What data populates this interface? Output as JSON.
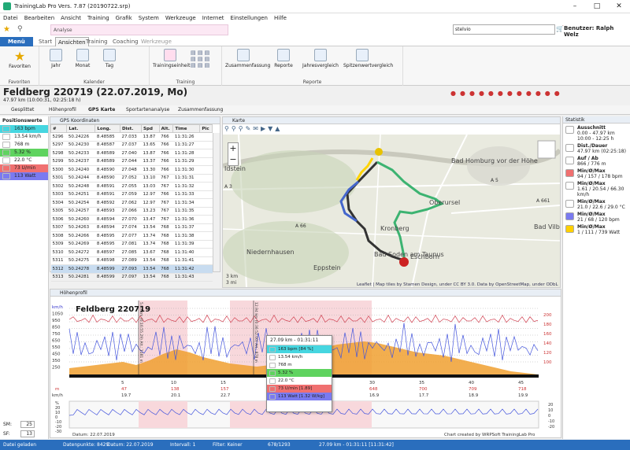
{
  "window": {
    "title": "TrainingLab Pro Vers. 7.87 (20190722.srp)"
  },
  "menu": [
    "Datei",
    "Bearbeiten",
    "Ansicht",
    "Training",
    "Grafik",
    "System",
    "Werkzeuge",
    "Internet",
    "Einstellungen",
    "Hilfe"
  ],
  "quick": {
    "analyse": "Analyse",
    "user_value": "stelvio",
    "user_label": "Benutzer: Ralph Welz"
  },
  "ribbon_tabs": [
    "Menü",
    "Start",
    "Ansichten",
    "Training",
    "Coaching",
    "Werkzeuge"
  ],
  "ribbon": {
    "favoriten": {
      "btn": "Favoriten",
      "label": "Favoriten"
    },
    "kalender": {
      "btns": [
        "Jahr",
        "Monat",
        "Tag"
      ],
      "label": "Kalender"
    },
    "training": {
      "btns": [
        "Trainingseinheit"
      ],
      "label": "Training"
    },
    "reporte": {
      "btns": [
        "Zusammenfassung",
        "Reporte",
        "Jahresvergleich",
        "Spitzenwertvergleich"
      ],
      "label": "Reporte"
    }
  },
  "session": {
    "title": "Feldberg 220719 (22.07.2019, Mo)",
    "sub": "47.97 km (10:00:31, 02:25:18 h)"
  },
  "subtabs": [
    "Gesplittet",
    "Höhenprofil",
    "GPS Karte",
    "Sportartenanalyse",
    "Zusammenfassung"
  ],
  "positions": {
    "head": "Positionswerte",
    "items": [
      {
        "text": "163 bpm",
        "color": "#46d6e0"
      },
      {
        "text": "13.54 km/h",
        "color": "#ffffff"
      },
      {
        "text": "768 m",
        "color": "#ffffff"
      },
      {
        "text": "5.32 %",
        "color": "#5fd35f"
      },
      {
        "text": "22.0 °C",
        "color": "#ffffff"
      },
      {
        "text": "73 U/min",
        "color": "#f07070"
      },
      {
        "text": "113 Watt",
        "color": "#7a7af0"
      }
    ],
    "sm_label": "SM:",
    "sm_value": "25",
    "sf_label": "SF:",
    "sf_value": "13"
  },
  "grid": {
    "head": "GPS Koordinaten",
    "columns": [
      "#",
      "Lat.",
      "Long.",
      "Dist.",
      "Spd",
      "Alt.",
      "Time",
      "Pic"
    ],
    "rows": [
      [
        "5296",
        "50.24226",
        "8.48585",
        "27.033",
        "13.87",
        "766",
        "11:31:26"
      ],
      [
        "5297",
        "50.24230",
        "8.48587",
        "27.037",
        "13.65",
        "766",
        "11:31:27"
      ],
      [
        "5298",
        "50.24233",
        "8.48589",
        "27.040",
        "13.87",
        "766",
        "11:31:28"
      ],
      [
        "5299",
        "50.24237",
        "8.48589",
        "27.044",
        "13.37",
        "766",
        "11:31:29"
      ],
      [
        "5300",
        "50.24240",
        "8.48590",
        "27.048",
        "13.30",
        "766",
        "11:31:30"
      ],
      [
        "5301",
        "50.24244",
        "8.48590",
        "27.052",
        "13.10",
        "767",
        "11:31:31"
      ],
      [
        "5302",
        "50.24248",
        "8.48591",
        "27.055",
        "13.03",
        "767",
        "11:31:32"
      ],
      [
        "5303",
        "50.24251",
        "8.48591",
        "27.059",
        "12.97",
        "766",
        "11:31:33"
      ],
      [
        "5304",
        "50.24254",
        "8.48592",
        "27.062",
        "12.97",
        "767",
        "11:31:34"
      ],
      [
        "5305",
        "50.24257",
        "8.48593",
        "27.066",
        "13.23",
        "767",
        "11:31:35"
      ],
      [
        "5306",
        "50.24260",
        "8.48594",
        "27.070",
        "13.47",
        "767",
        "11:31:36"
      ],
      [
        "5307",
        "50.24263",
        "8.48594",
        "27.074",
        "13.54",
        "768",
        "11:31:37"
      ],
      [
        "5308",
        "50.24266",
        "8.48595",
        "27.077",
        "13.74",
        "768",
        "11:31:38"
      ],
      [
        "5309",
        "50.24269",
        "8.48595",
        "27.081",
        "13.74",
        "768",
        "11:31:39"
      ],
      [
        "5310",
        "50.24272",
        "8.48597",
        "27.085",
        "13.67",
        "768",
        "11:31:40"
      ],
      [
        "5311",
        "50.24275",
        "8.48598",
        "27.089",
        "13.54",
        "768",
        "11:31:41"
      ],
      [
        "5312",
        "50.24278",
        "8.48599",
        "27.093",
        "13.54",
        "768",
        "11:31:42"
      ],
      [
        "5313",
        "50.24281",
        "8.48599",
        "27.097",
        "13.54",
        "768",
        "11:31:43"
      ]
    ]
  },
  "map": {
    "head": "Karte",
    "places": [
      "Bad Homburg vor der Höhe",
      "Bad Vilbel",
      "Niedernhausen",
      "Eppstein",
      "Kronberg",
      "Bad Soden am Taunus",
      "Eschborn",
      "Oberursel",
      "Idstein"
    ],
    "roads": [
      "A 3",
      "A 5",
      "A 661",
      "A 66"
    ],
    "scale": "3 km",
    "scale2": "3 mi",
    "attribution": "Leaflet | Map tiles by Stamen Design, under CC BY 3.0. Data by OpenStreetMap, under ODbL"
  },
  "stats": {
    "head": "Statistik",
    "items": [
      {
        "k": "Ausschnitt",
        "v": "0.00 - 47.97 km\n10:00 - 12:25 h",
        "color": "#ffffff"
      },
      {
        "k": "Dist./Dauer",
        "v": "47.97 km (02:25:18)",
        "color": "#ffffff"
      },
      {
        "k": "Auf / Ab",
        "v": "866 / 776 m",
        "color": "#ffffff"
      },
      {
        "k": "Min/Ø/Max",
        "v": "94 / 157 / 178 bpm",
        "color": "#f07070"
      },
      {
        "k": "Min/Ø/Max",
        "v": "1.61 / 20.54 / 66.30 km/h",
        "color": "#ffffff"
      },
      {
        "k": "Min/Ø/Max",
        "v": "21.0 / 22.6 / 29.0 °C",
        "color": "#ffffff"
      },
      {
        "k": "Min/Ø/Max",
        "v": "21 / 68 / 120 bpm",
        "color": "#7a7af0"
      },
      {
        "k": "Min/Ø/Max",
        "v": "1 / 111 / 739 Watt",
        "color": "#ffd000"
      }
    ]
  },
  "chart": {
    "head": "Höhenprofil",
    "title": "Feldberg 220719",
    "left_axis_labels": [
      "km/h",
      "1050",
      "950",
      "850",
      "750",
      "650",
      "550",
      "450",
      "350",
      "250"
    ],
    "right_axis_labels": [
      "200",
      "180",
      "160",
      "140",
      "120",
      "100"
    ],
    "km_ticks": [
      "5",
      "10",
      "15",
      "20",
      "25",
      "30",
      "35",
      "40",
      "45"
    ],
    "row_m": [
      "47",
      "138",
      "157",
      "",
      "",
      "648",
      "700",
      "709",
      "718"
    ],
    "row_kmh": [
      "19.7",
      "20.1",
      "22.7",
      "",
      "",
      "16.9",
      "17.7",
      "18.9",
      "19.9"
    ],
    "left_unit_m": "m",
    "left_unit_kmh": "km/h",
    "lower_left": [
      "%",
      "20",
      "10",
      "0",
      "-10",
      "-20",
      "-30"
    ],
    "lower_right": [
      "20",
      "10",
      "0",
      "-10",
      "-20"
    ],
    "markers": [
      "5.85 km (0:16:55.29) Alt.: 1181 m",
      "12.94 km (0:36:52.00) Alt.: 878 m"
    ],
    "date_label": "Datum: 22.07.2019",
    "credit": "Chart created by WRPSoft TrainingLab Pro",
    "tooltip": {
      "head": "27.09 km - 01:31:11",
      "rows": [
        {
          "t": "163 bpm [84 %]",
          "color": "#46d6e0"
        },
        {
          "t": "13.54 km/h",
          "color": "#ffffff"
        },
        {
          "t": "768 m",
          "color": "#ffffff"
        },
        {
          "t": "5.32 %",
          "color": "#5fd35f"
        },
        {
          "t": "22.0 °C",
          "color": "#ffffff"
        },
        {
          "t": "73 U/min [1.89]",
          "color": "#f07070"
        },
        {
          "t": "113 Watt [1.32 W/kg]",
          "color": "#7a7af0"
        }
      ]
    }
  },
  "status": [
    "Datei geladen",
    "Datenpunkte: 8429",
    "Datum: 22.07.2019",
    "Intervall: 1",
    "Filter: Keiner",
    "678/1293",
    "27.09 km - 01:31:11 [11:31:42]"
  ]
}
